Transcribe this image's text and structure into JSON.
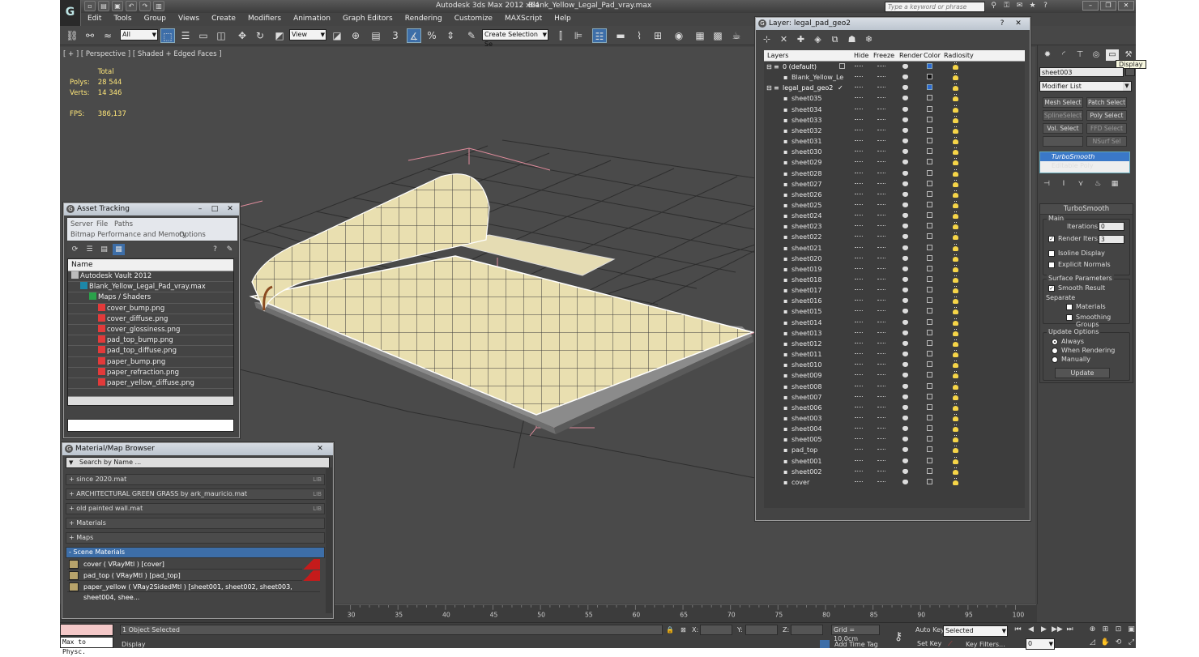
{
  "app": {
    "title": "Autodesk 3ds Max  2012 x64",
    "file": "Blank_Yellow_Legal_Pad_vray.max",
    "search_placeholder": "Type a keyword or phrase",
    "logo_glyph": "G"
  },
  "menu": [
    "Edit",
    "Tools",
    "Group",
    "Views",
    "Create",
    "Modifiers",
    "Animation",
    "Graph Editors",
    "Rendering",
    "Customize",
    "MAXScript",
    "Help"
  ],
  "toolbar": {
    "selection_filter": "All",
    "ref_coord": "View",
    "named_selection": "Create Selection Se"
  },
  "viewport": {
    "label": "[ + ] [ Perspective ] [ Shaded + Edged Faces ]",
    "stats": {
      "total_label": "Total",
      "polys_label": "Polys:",
      "polys": "28 544",
      "verts_label": "Verts:",
      "verts": "14 346",
      "fps_label": "FPS:",
      "fps": "386,137"
    }
  },
  "asset_tracking": {
    "title": "Asset Tracking",
    "menu": [
      "Server",
      "File",
      "Paths",
      "Bitmap Performance and Memory",
      "Options"
    ],
    "column": "Name",
    "rows": [
      {
        "level": 1,
        "label": "Autodesk Vault 2012",
        "icon": "vault-icon"
      },
      {
        "level": 2,
        "label": "Blank_Yellow_Legal_Pad_vray.max",
        "icon": "max-file-icon"
      },
      {
        "level": 3,
        "label": "Maps / Shaders",
        "icon": "maps-icon"
      },
      {
        "level": 4,
        "label": "cover_bump.png",
        "icon": "png-icon"
      },
      {
        "level": 4,
        "label": "cover_diffuse.png",
        "icon": "png-icon"
      },
      {
        "level": 4,
        "label": "cover_glossiness.png",
        "icon": "png-icon"
      },
      {
        "level": 4,
        "label": "pad_top_bump.png",
        "icon": "png-icon"
      },
      {
        "level": 4,
        "label": "pad_top_diffuse.png",
        "icon": "png-icon"
      },
      {
        "level": 4,
        "label": "paper_bump.png",
        "icon": "png-icon"
      },
      {
        "level": 4,
        "label": "paper_refraction.png",
        "icon": "png-icon"
      },
      {
        "level": 4,
        "label": "paper_yellow_diffuse.png",
        "icon": "png-icon"
      }
    ]
  },
  "material_browser": {
    "title": "Material/Map Browser",
    "search_placeholder": "Search by Name ...",
    "groups": [
      {
        "label": "+ since 2020.mat",
        "tag": "LIB"
      },
      {
        "label": "+ ARCHITECTURAL GREEN GRASS by ark_mauricio.mat",
        "tag": "LIB"
      },
      {
        "label": "+ old painted wall.mat",
        "tag": "LIB"
      },
      {
        "label": "+ Materials",
        "tag": ""
      },
      {
        "label": "+ Maps",
        "tag": ""
      },
      {
        "label": "- Scene Materials",
        "tag": ""
      }
    ],
    "scene_materials": [
      "cover  ( VRayMtl )  [cover]",
      "pad_top  ( VRayMtl )  [pad_top]",
      "paper_yellow  ( VRay2SidedMtl )  [sheet001, sheet002, sheet003, sheet004, shee..."
    ]
  },
  "layer_dialog": {
    "title": "Layer: legal_pad_geo2",
    "columns": [
      "Layers",
      "Hide",
      "Freeze",
      "Render",
      "Color",
      "Radiosity"
    ],
    "rows": [
      {
        "name": "0 (default)",
        "type": "layer",
        "color": "blue",
        "check": "box"
      },
      {
        "name": "Blank_Yellow_Le",
        "type": "object",
        "color": "black",
        "check": ""
      },
      {
        "name": "legal_pad_geo2",
        "type": "layer",
        "color": "blue",
        "check": "tick"
      },
      {
        "name": "sheet035"
      },
      {
        "name": "sheet034"
      },
      {
        "name": "sheet033"
      },
      {
        "name": "sheet032"
      },
      {
        "name": "sheet031"
      },
      {
        "name": "sheet030"
      },
      {
        "name": "sheet029"
      },
      {
        "name": "sheet028"
      },
      {
        "name": "sheet027"
      },
      {
        "name": "sheet026"
      },
      {
        "name": "sheet025"
      },
      {
        "name": "sheet024"
      },
      {
        "name": "sheet023"
      },
      {
        "name": "sheet022"
      },
      {
        "name": "sheet021"
      },
      {
        "name": "sheet020"
      },
      {
        "name": "sheet019"
      },
      {
        "name": "sheet018"
      },
      {
        "name": "sheet017"
      },
      {
        "name": "sheet016"
      },
      {
        "name": "sheet015"
      },
      {
        "name": "sheet014"
      },
      {
        "name": "sheet013"
      },
      {
        "name": "sheet012"
      },
      {
        "name": "sheet011"
      },
      {
        "name": "sheet010"
      },
      {
        "name": "sheet009"
      },
      {
        "name": "sheet008"
      },
      {
        "name": "sheet007"
      },
      {
        "name": "sheet006"
      },
      {
        "name": "sheet003"
      },
      {
        "name": "sheet004"
      },
      {
        "name": "sheet005"
      },
      {
        "name": "pad_top"
      },
      {
        "name": "sheet001"
      },
      {
        "name": "sheet002"
      },
      {
        "name": "cover"
      }
    ]
  },
  "command_panel": {
    "tooltip": "Display",
    "object_name": "sheet003",
    "modifier_list": "Modifier List",
    "mod_buttons": [
      "Mesh Select",
      "Patch Select",
      "SplineSelect",
      "Poly Select",
      "Vol. Select",
      "FFD Select",
      "",
      "NSurf Sel"
    ],
    "stack": [
      "TurboSmooth",
      "Editable Poly"
    ],
    "rollout": {
      "title": "TurboSmooth",
      "main": "Main",
      "iterations_label": "Iterations:",
      "iterations": "0",
      "render_iters_label": "Render Iters:",
      "render_iters": "3",
      "isoline": "Isoline Display",
      "explicit_normals": "Explicit Normals",
      "surface_params": "Surface Parameters",
      "smooth_result": "Smooth Result",
      "separate": "Separate",
      "materials": "Materials",
      "smoothing_groups": "Smoothing Groups",
      "update_options": "Update Options",
      "always": "Always",
      "when_rendering": "When Rendering",
      "manually": "Manually",
      "update_btn": "Update"
    }
  },
  "timeline": {
    "ticks": [
      "30",
      "35",
      "40",
      "45",
      "50",
      "55",
      "60",
      "65",
      "70",
      "75",
      "80",
      "85",
      "90",
      "95",
      "100"
    ]
  },
  "status": {
    "maxscript": "Max to Physc.",
    "selected": "1 Object Selected",
    "prompt": "Display",
    "x_label": "X:",
    "y_label": "Y:",
    "z_label": "Z:",
    "grid": "Grid = 10,0cm",
    "add_time_tag": "Add Time Tag",
    "auto_key": "Auto Key",
    "set_key": "Set Key",
    "key_mode": "Selected",
    "key_filters": "Key Filters...",
    "frame": "0"
  }
}
